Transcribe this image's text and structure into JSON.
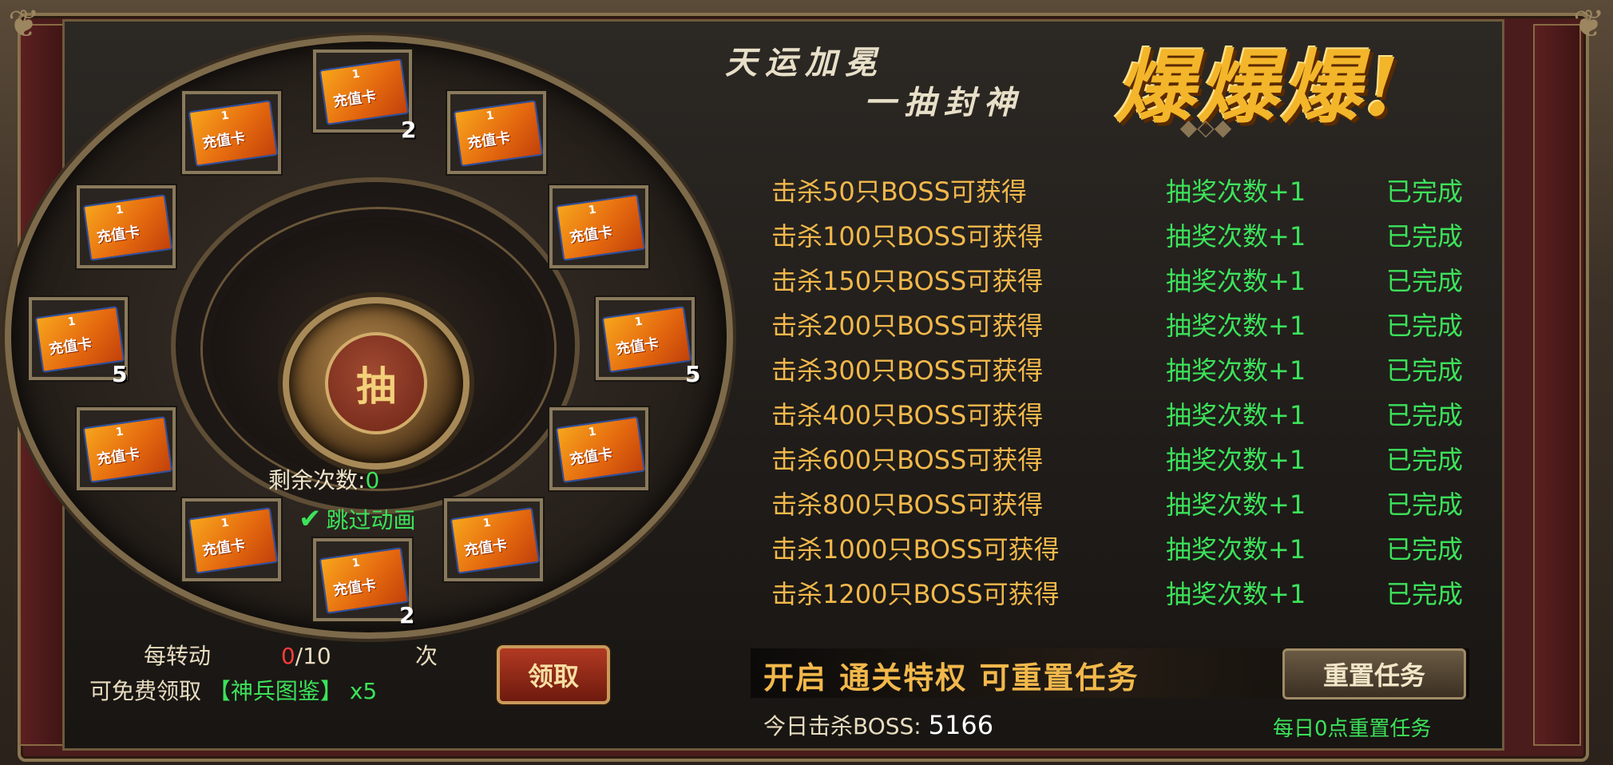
{
  "header": {
    "slogan_line1": "天运加冕",
    "slogan_line2": "一抽封神",
    "boom": "爆爆爆!"
  },
  "wheel": {
    "draw_button_label": "抽",
    "remaining_label": "剩余次数:",
    "remaining_value": "0",
    "skip_animation_label": "跳过动画",
    "skip_animation_checked": true,
    "slots": [
      {
        "card_value": "1",
        "card_text": "充值卡",
        "count": "2"
      },
      {
        "card_value": "1",
        "card_text": "充值卡",
        "count": ""
      },
      {
        "card_value": "1",
        "card_text": "充值卡",
        "count": ""
      },
      {
        "card_value": "1",
        "card_text": "充值卡",
        "count": "5"
      },
      {
        "card_value": "1",
        "card_text": "充值卡",
        "count": ""
      },
      {
        "card_value": "1",
        "card_text": "充值卡",
        "count": ""
      },
      {
        "card_value": "1",
        "card_text": "充值卡",
        "count": "2"
      },
      {
        "card_value": "1",
        "card_text": "充值卡",
        "count": ""
      },
      {
        "card_value": "1",
        "card_text": "充值卡",
        "count": ""
      },
      {
        "card_value": "1",
        "card_text": "充值卡",
        "count": "5"
      },
      {
        "card_value": "1",
        "card_text": "充值卡",
        "count": ""
      },
      {
        "card_value": "1",
        "card_text": "充值卡",
        "count": ""
      }
    ]
  },
  "bonus": {
    "per_turn_label": "每转动",
    "current": "0",
    "total": "/10",
    "unit": "次",
    "free_claim_label": "可免费领取",
    "reward_item": "【神兵图鉴】",
    "reward_qty": "x5",
    "claim_button": "领取"
  },
  "tasks": [
    {
      "condition": "击杀50只BOSS可获得",
      "reward": "抽奖次数+1",
      "status": "已完成"
    },
    {
      "condition": "击杀100只BOSS可获得",
      "reward": "抽奖次数+1",
      "status": "已完成"
    },
    {
      "condition": "击杀150只BOSS可获得",
      "reward": "抽奖次数+1",
      "status": "已完成"
    },
    {
      "condition": "击杀200只BOSS可获得",
      "reward": "抽奖次数+1",
      "status": "已完成"
    },
    {
      "condition": "击杀300只BOSS可获得",
      "reward": "抽奖次数+1",
      "status": "已完成"
    },
    {
      "condition": "击杀400只BOSS可获得",
      "reward": "抽奖次数+1",
      "status": "已完成"
    },
    {
      "condition": "击杀600只BOSS可获得",
      "reward": "抽奖次数+1",
      "status": "已完成"
    },
    {
      "condition": "击杀800只BOSS可获得",
      "reward": "抽奖次数+1",
      "status": "已完成"
    },
    {
      "condition": "击杀1000只BOSS可获得",
      "reward": "抽奖次数+1",
      "status": "已完成"
    },
    {
      "condition": "击杀1200只BOSS可获得",
      "reward": "抽奖次数+1",
      "status": "已完成"
    }
  ],
  "footer": {
    "privilege_text": "开启 通关特权 可重置任务",
    "reset_button": "重置任务",
    "today_label": "今日击杀BOSS:",
    "today_value": "5166",
    "daily_reset_note": "每日0点重置任务"
  },
  "colors": {
    "gold_text": "#f2b84b",
    "green_text": "#3ce25a",
    "red_value": "#ff3a3a",
    "card_orange": "#e56a0f"
  }
}
